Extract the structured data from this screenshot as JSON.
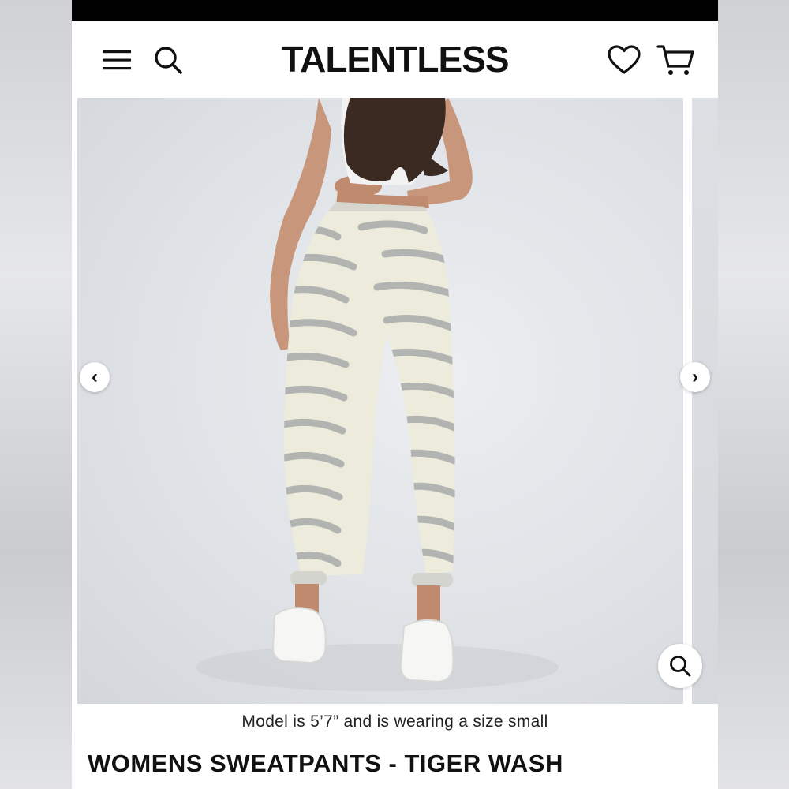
{
  "header": {
    "brand": "TALENTLESS",
    "icons": {
      "menu": "hamburger-menu-icon",
      "search": "search-icon",
      "wishlist": "heart-icon",
      "cart": "cart-icon"
    }
  },
  "gallery": {
    "prev_arrow": "‹",
    "next_arrow": "›",
    "zoom_icon": "zoom-search-icon"
  },
  "product": {
    "caption": "Model is 5’7” and is wearing a size small",
    "title": "WOMENS SWEATPANTS - TIGER WASH"
  },
  "colors": {
    "status_bar": "#000000",
    "text": "#111111",
    "pants_base": "#ecebdc",
    "pants_stripes": "#a9abaa"
  }
}
